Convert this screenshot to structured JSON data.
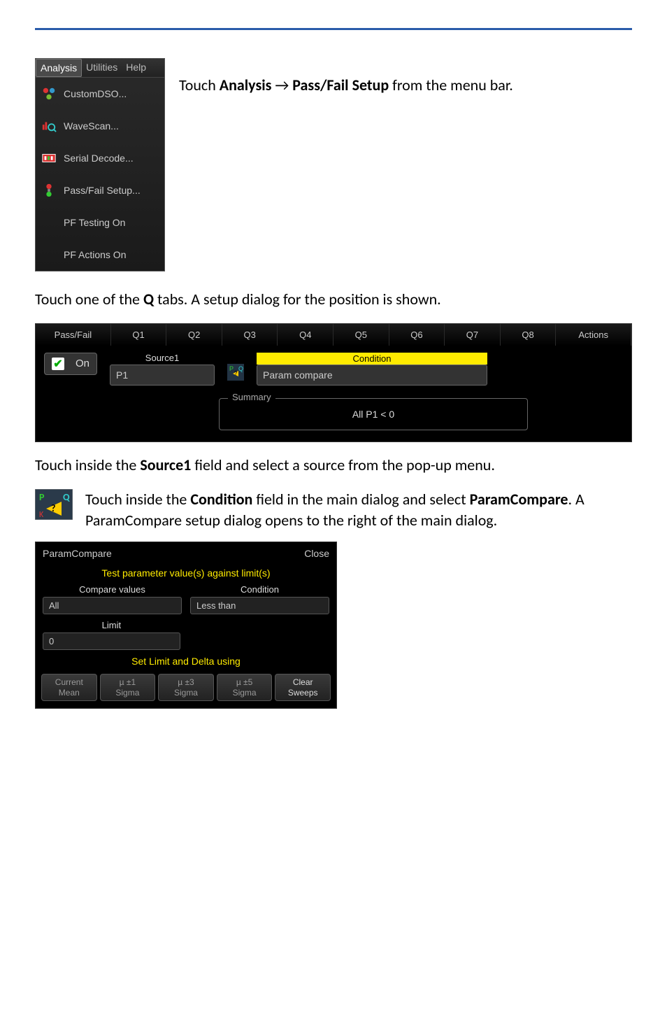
{
  "intro_text_prefix": "Touch ",
  "intro_bold1": "Analysis",
  "intro_arrow": " → ",
  "intro_bold2": "Pass/Fail Setup",
  "intro_text_suffix": " from the menu bar.",
  "menu_bar": {
    "analysis": "Analysis",
    "utilities": "Utilities",
    "help": "Help"
  },
  "menu_items": {
    "customdso": "CustomDSO...",
    "wavescan": "WaveScan...",
    "serialdecode": "Serial Decode...",
    "passfail": "Pass/Fail Setup...",
    "pftesting": "PF Testing On",
    "pfactions": "PF Actions On"
  },
  "para2_prefix": "Touch one of the ",
  "para2_bold": "Q",
  "para2_suffix": " tabs. A setup dialog for the position is shown.",
  "tabs": {
    "passfail": "Pass/Fail",
    "q1": "Q1",
    "q2": "Q2",
    "q3": "Q3",
    "q4": "Q4",
    "q5": "Q5",
    "q6": "Q6",
    "q7": "Q7",
    "q8": "Q8",
    "actions": "Actions"
  },
  "q_dialog": {
    "on": "On",
    "source_label": "Source1",
    "source_value": "P1",
    "condition_label": "Condition",
    "condition_value": "Param compare",
    "summary_label": "Summary",
    "summary_value": "All P1 < 0"
  },
  "para3_prefix": "Touch inside the ",
  "para3_bold": "Source1",
  "para3_suffix": " field and select a source from the pop-up menu.",
  "para4_prefix": "Touch inside the ",
  "para4_bold1": "Condition",
  "para4_mid": " field in the main dialog and select ",
  "para4_bold2": "ParamCompare",
  "para4_suffix": ". A ParamCompare setup dialog opens to the right of the main dialog.",
  "param_panel": {
    "title": "ParamCompare",
    "close": "Close",
    "heading": "Test parameter value(s) against limit(s)",
    "compare_label": "Compare values",
    "compare_value": "All",
    "condition_label": "Condition",
    "condition_value": "Less than",
    "limit_label": "Limit",
    "limit_value": "0",
    "set_heading": "Set Limit and Delta using",
    "btn_current_mean_1": "Current",
    "btn_current_mean_2": "Mean",
    "btn_s1_1": "µ ±1",
    "btn_s1_2": "Sigma",
    "btn_s3_1": "µ ±3",
    "btn_s3_2": "Sigma",
    "btn_s5_1": "µ ±5",
    "btn_s5_2": "Sigma",
    "btn_clear_1": "Clear",
    "btn_clear_2": "Sweeps"
  }
}
